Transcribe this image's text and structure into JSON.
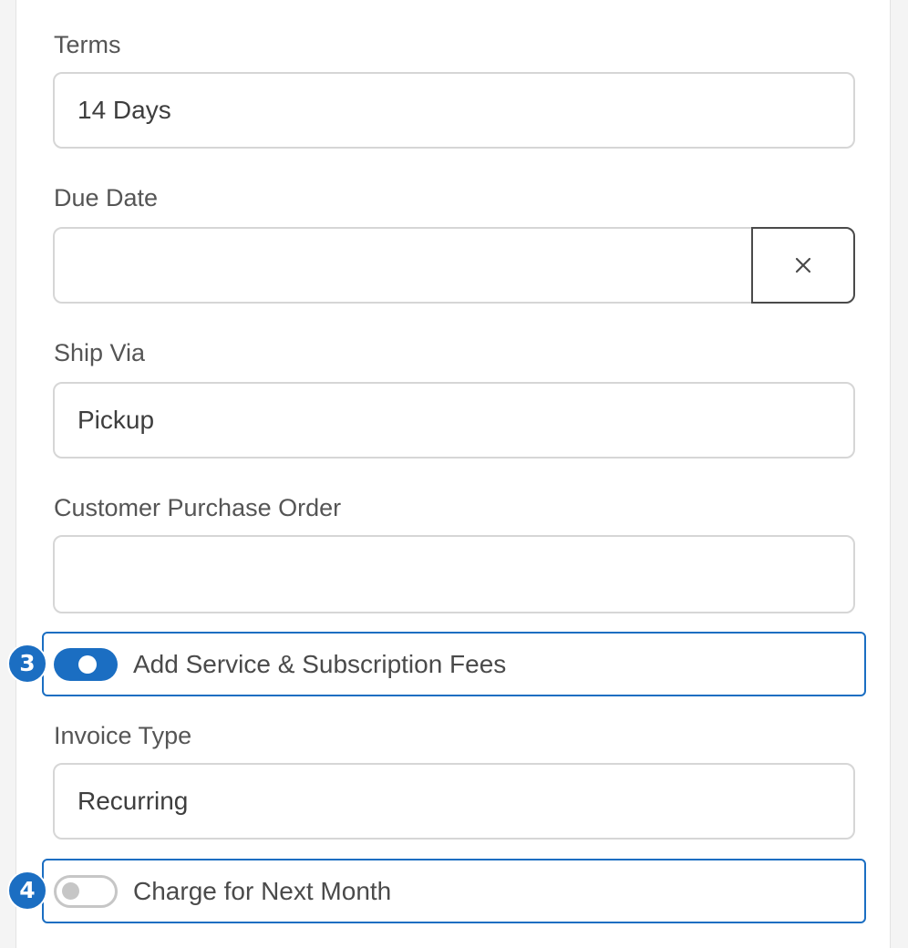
{
  "form": {
    "terms": {
      "label": "Terms",
      "value": "14 Days"
    },
    "due_date": {
      "label": "Due Date",
      "value": "",
      "clear_icon": "close-icon"
    },
    "ship_via": {
      "label": "Ship Via",
      "value": "Pickup"
    },
    "customer_po": {
      "label": "Customer Purchase Order",
      "value": ""
    },
    "service_fees": {
      "label": "Add Service & Subscription Fees",
      "enabled": true,
      "step": "3"
    },
    "invoice_type": {
      "label": "Invoice Type",
      "value": "Recurring"
    },
    "next_month": {
      "label": "Charge for Next Month",
      "enabled": false,
      "step": "4"
    }
  },
  "colors": {
    "accent": "#1b6ec2",
    "border": "#d6d6d6",
    "label_text": "#555555",
    "toggle_off": "#c6c6c6"
  }
}
